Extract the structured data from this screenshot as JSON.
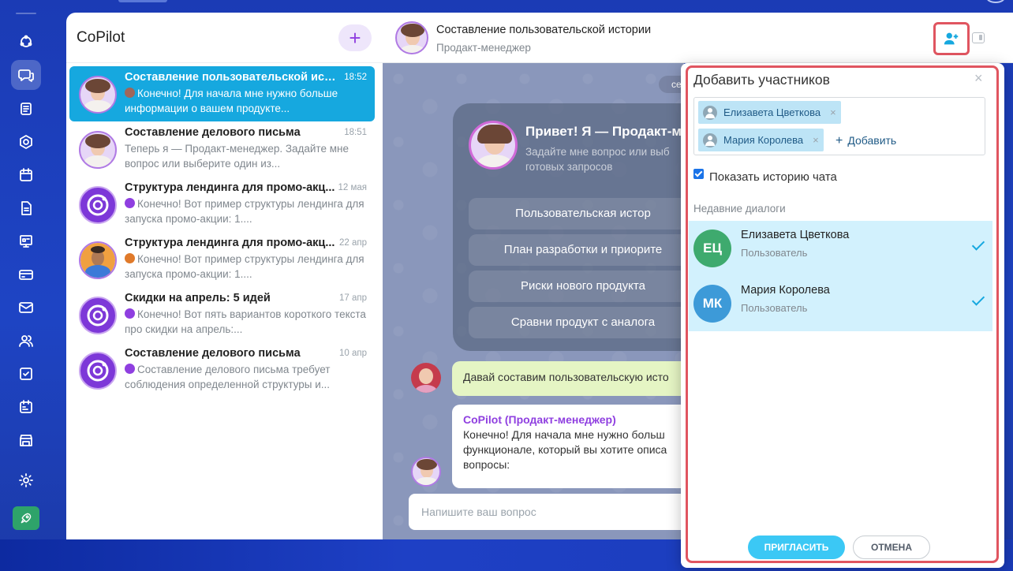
{
  "chat_list": {
    "title": "CoPilot",
    "add_label": "+",
    "items": [
      {
        "title": "Составление пользовательской исто...",
        "time": "18:52",
        "message": "Конечно! Для начала мне нужно больше информации о вашем продукте...",
        "active": true,
        "avatar": "woman"
      },
      {
        "title": "Составление делового письма",
        "time": "18:51",
        "message": "Теперь я — Продакт-менеджер. Задайте мне вопрос или выберите один из...",
        "active": false,
        "avatar": "woman"
      },
      {
        "title": "Структура лендинга для промо-акц...",
        "time": "12 мая",
        "message": "Конечно! Вот пример структуры лендинга для запуска промо-акции: 1....",
        "active": false,
        "avatar": "copilot"
      },
      {
        "title": "Структура лендинга для промо-акц...",
        "time": "22 апр",
        "message": "Конечно! Вот пример структуры лендинга для запуска промо-акции: 1....",
        "active": false,
        "avatar": "man"
      },
      {
        "title": "Скидки на апрель: 5 идей",
        "time": "17 апр",
        "message": "Конечно! Вот пять вариантов короткого текста про скидки на апрель:...",
        "active": false,
        "avatar": "copilot"
      },
      {
        "title": "Составление делового письма",
        "time": "10 апр",
        "message": "Составление делового письма требует соблюдения определенной структуры и...",
        "active": false,
        "avatar": "copilot"
      }
    ]
  },
  "chat": {
    "title": "Составление пользовательской истории",
    "subtitle": "Продакт-менеджер",
    "date_pill": "се",
    "welcome_title": "Привет! Я — Продакт-м",
    "welcome_sub": "Задайте мне вопрос или выб готовых запросов",
    "prompts": [
      "Пользовательская истор",
      "План разработки и приорите",
      "Риски нового продукта",
      "Сравни продукт с аналога"
    ],
    "user_message": "Давай составим пользовательскую исто",
    "bot_name": "CoPilot (Продакт-менеджер)",
    "bot_message": "Конечно! Для начала мне нужно больш\nфункционале, который вы хотите описа\nвопросы:",
    "input_placeholder": "Напишите ваш вопрос"
  },
  "dialog": {
    "title": "Добавить участников",
    "close": "×",
    "tags": [
      {
        "name": "Елизавета Цветкова",
        "remove": "×"
      },
      {
        "name": "Мария Королева",
        "remove": "×"
      }
    ],
    "add_plus": "+",
    "add_label": "Добавить",
    "show_history_label": "Показать историю чата",
    "show_history_checked": true,
    "recent_label": "Недавние диалоги",
    "recent": [
      {
        "initials": "ЕЦ",
        "name": "Елизавета Цветкова",
        "role": "Пользователь",
        "color": "#3eaa6e",
        "selected": true
      },
      {
        "initials": "МК",
        "name": "Мария Королева",
        "role": "Пользователь",
        "color": "#3d9ad8",
        "selected": true
      }
    ],
    "invite_label": "ПРИГЛАСИТЬ",
    "cancel_label": "ОТМЕНА"
  },
  "colors": {
    "accent": "#16a8df",
    "highlight": "#e05560",
    "brand_purple": "#8f3fe0"
  }
}
